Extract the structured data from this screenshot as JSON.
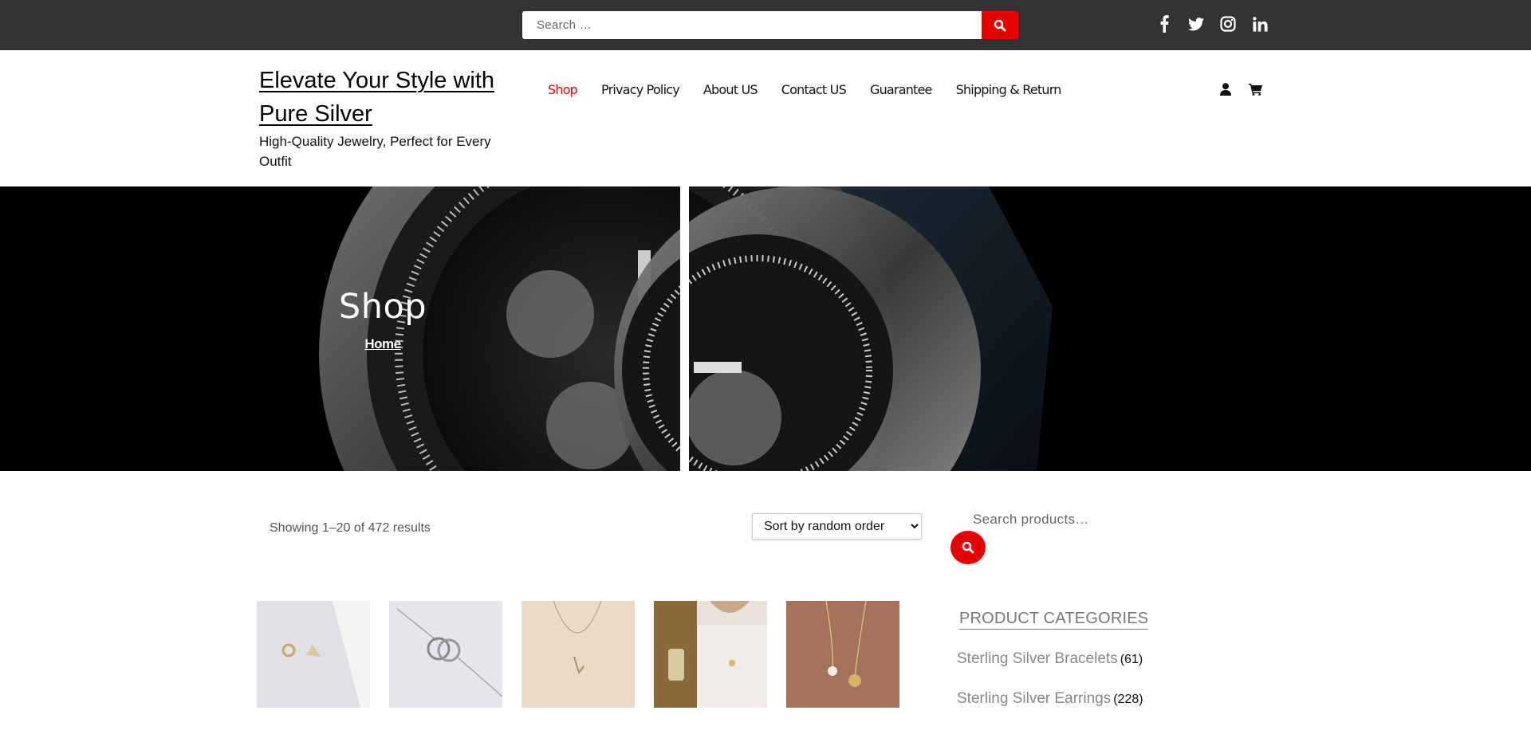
{
  "topbar": {
    "search_placeholder": "Search …",
    "social": [
      "facebook-icon",
      "twitter-icon",
      "instagram-icon",
      "linkedin-icon"
    ]
  },
  "header": {
    "site_title": "Elevate Your Style with Pure Silver",
    "tagline": "High-Quality Jewelry, Perfect for Every Outfit",
    "nav": [
      {
        "label": "Shop",
        "active": true
      },
      {
        "label": "Privacy Policy",
        "active": false
      },
      {
        "label": "About US",
        "active": false
      },
      {
        "label": "Contact US",
        "active": false
      },
      {
        "label": "Guarantee",
        "active": false
      },
      {
        "label": "Shipping & Return",
        "active": false
      }
    ],
    "icons": [
      "user-icon",
      "cart-icon"
    ]
  },
  "hero": {
    "title": "Shop",
    "breadcrumb": "Home"
  },
  "shop": {
    "result_count": "Showing 1–20 of 472 results",
    "sort_selected": "Sort by random order"
  },
  "sidebar": {
    "search_placeholder": "Search products…",
    "categories_title": "PRODUCT CATEGORIES",
    "categories": [
      {
        "name": "Sterling Silver Bracelets",
        "count": "(61)"
      },
      {
        "name": "Sterling Silver Earrings",
        "count": "(228)"
      }
    ]
  },
  "colors": {
    "accent": "#e80000",
    "topbar": "#333333"
  }
}
